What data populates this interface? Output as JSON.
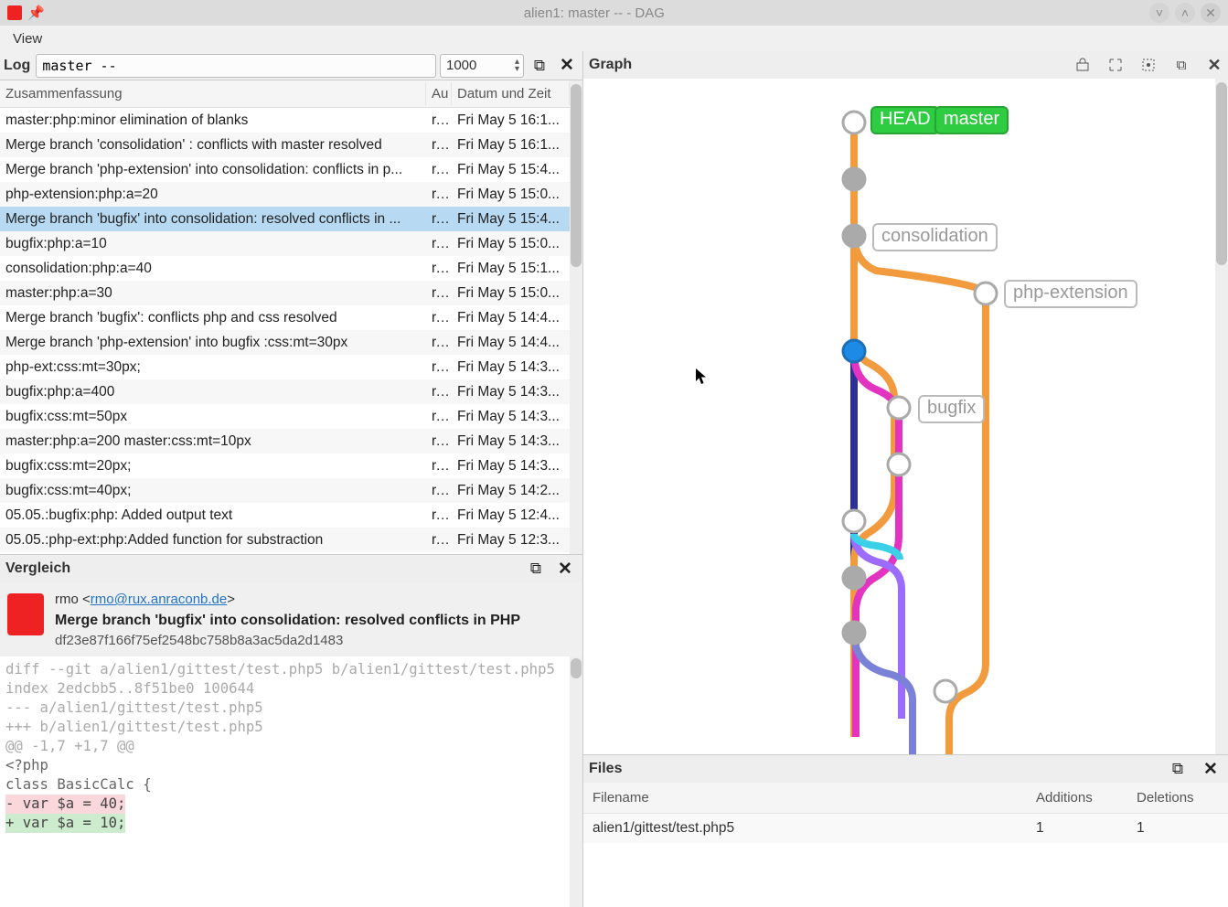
{
  "window": {
    "title": "alien1: master -- - DAG"
  },
  "menu": {
    "view": "View"
  },
  "log": {
    "label": "Log",
    "rev_value": "master --",
    "limit": "1000",
    "columns": [
      "Zusammenfassung",
      "Au",
      "Datum und Zeit"
    ],
    "rows": [
      {
        "summary": "master:php:minor elimination of blanks",
        "author": "r...",
        "date": "Fri May 5 16:1...",
        "sel": false
      },
      {
        "summary": "Merge branch 'consolidation' : conflicts with master resolved",
        "author": "r...",
        "date": "Fri May 5 16:1...",
        "sel": false
      },
      {
        "summary": "Merge branch 'php-extension' into consolidation: conflicts in p...",
        "author": "r...",
        "date": "Fri May 5 15:4...",
        "sel": false
      },
      {
        "summary": "php-extension:php:a=20",
        "author": "r...",
        "date": "Fri May 5 15:0...",
        "sel": false
      },
      {
        "summary": "Merge branch 'bugfix' into consolidation: resolved conflicts in ...",
        "author": "r...",
        "date": "Fri May 5 15:4...",
        "sel": true
      },
      {
        "summary": "bugfix:php:a=10",
        "author": "r...",
        "date": "Fri May 5 15:0...",
        "sel": false
      },
      {
        "summary": "consolidation:php:a=40",
        "author": "r...",
        "date": "Fri May 5 15:1...",
        "sel": false
      },
      {
        "summary": "master:php:a=30",
        "author": "r...",
        "date": "Fri May 5 15:0...",
        "sel": false
      },
      {
        "summary": "Merge branch 'bugfix': conflicts php and css resolved",
        "author": "r...",
        "date": "Fri May 5 14:4...",
        "sel": false
      },
      {
        "summary": "Merge branch 'php-extension' into bugfix :css:mt=30px",
        "author": "r...",
        "date": "Fri May 5 14:4...",
        "sel": false
      },
      {
        "summary": "php-ext:css:mt=30px;",
        "author": "r...",
        "date": "Fri May 5 14:3...",
        "sel": false
      },
      {
        "summary": "bugfix:php:a=400",
        "author": "r...",
        "date": "Fri May 5 14:3...",
        "sel": false
      },
      {
        "summary": "bugfix:css:mt=50px",
        "author": "r...",
        "date": "Fri May 5 14:3...",
        "sel": false
      },
      {
        "summary": "master:php:a=200 master:css:mt=10px",
        "author": "r...",
        "date": "Fri May 5 14:3...",
        "sel": false
      },
      {
        "summary": "bugfix:css:mt=20px;",
        "author": "r...",
        "date": "Fri May 5 14:3...",
        "sel": false
      },
      {
        "summary": "bugfix:css:mt=40px;",
        "author": "r...",
        "date": "Fri May 5 14:2...",
        "sel": false
      },
      {
        "summary": "05.05.:bugfix:php: Added output text",
        "author": "r...",
        "date": "Fri May 5 12:4...",
        "sel": false
      },
      {
        "summary": "05.05.:php-ext:php:Added function for substraction",
        "author": "r...",
        "date": "Fri May 5 12:3...",
        "sel": false
      }
    ]
  },
  "vergleich": {
    "title": "Vergleich",
    "author_name": "rmo",
    "author_pre": " <",
    "author_email": "rmo@rux.anraconb.de",
    "author_post": ">",
    "subject": "Merge branch 'bugfix' into consolidation: resolved conflicts in PHP",
    "hash": "df23e87f166f75ef2548bc758b8a3ac5da2d1483",
    "diff": {
      "l1": "diff --git a/alien1/gittest/test.php5 b/alien1/gittest/test.php5",
      "l2": "index 2edcbb5..8f51be0 100644",
      "l3": "--- a/alien1/gittest/test.php5",
      "l4": "+++ b/alien1/gittest/test.php5",
      "hunk": "@@ -1,7 +1,7 @@",
      "ctx1": " <?php",
      "ctx2": " class BasicCalc {",
      "del": "-    var $a = 40;",
      "add": "+    var $a = 10;"
    }
  },
  "graph": {
    "title": "Graph",
    "refs": {
      "head": "HEAD",
      "master": "master",
      "consolidation": "consolidation",
      "php_extension": "php-extension",
      "bugfix": "bugfix"
    }
  },
  "files": {
    "title": "Files",
    "columns": [
      "Filename",
      "Additions",
      "Deletions"
    ],
    "rows": [
      {
        "name": "alien1/gittest/test.php5",
        "add": "1",
        "del": "1"
      }
    ]
  }
}
